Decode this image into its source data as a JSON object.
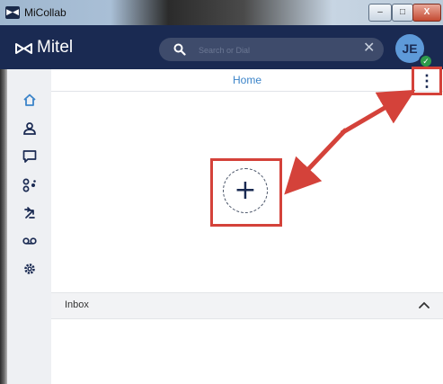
{
  "window": {
    "title": "MiCollab",
    "app_icon_glyph": "ꟷ",
    "close_glyph": "X",
    "min_glyph": "‒",
    "max_glyph": "□"
  },
  "header": {
    "brand": "Mitel",
    "search_placeholder": "Search or Dial",
    "clear_glyph": "✕",
    "avatar_initials": "JE",
    "presence_glyph": "✓",
    "background_color": "#1a2a52"
  },
  "sidebar": {
    "items": [
      {
        "name": "home",
        "icon": "home-icon",
        "active": true
      },
      {
        "name": "contacts",
        "icon": "person-icon"
      },
      {
        "name": "chat",
        "icon": "chat-bubble-icon"
      },
      {
        "name": "conferences",
        "icon": "group-icon"
      },
      {
        "name": "calls",
        "icon": "phone-transfer-icon"
      },
      {
        "name": "voicemail",
        "icon": "voicemail-icon"
      },
      {
        "name": "settings",
        "icon": "gear-icon"
      }
    ]
  },
  "main": {
    "title": "Home",
    "menu_glyph": "⋮",
    "add_glyph": "+",
    "highlight_color": "#d4423a",
    "accent_color": "#3b84c9"
  },
  "inbox": {
    "label": "Inbox"
  }
}
